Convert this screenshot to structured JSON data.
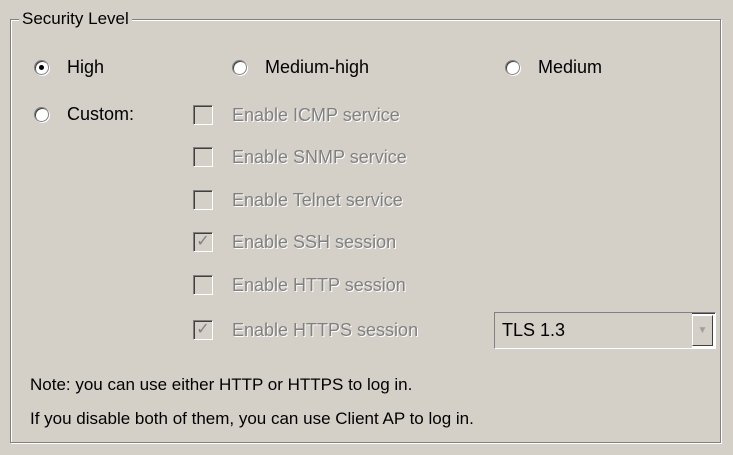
{
  "group": {
    "title": "Security Level"
  },
  "levels": {
    "high": "High",
    "medium_high": "Medium-high",
    "medium": "Medium",
    "custom": "Custom:",
    "selected": "high"
  },
  "services": [
    {
      "label": "Enable ICMP service",
      "checked": false,
      "enabled": false
    },
    {
      "label": "Enable SNMP service",
      "checked": false,
      "enabled": false
    },
    {
      "label": "Enable Telnet service",
      "checked": false,
      "enabled": false
    },
    {
      "label": "Enable SSH session",
      "checked": true,
      "enabled": false
    },
    {
      "label": "Enable HTTP session",
      "checked": false,
      "enabled": false
    },
    {
      "label": "Enable HTTPS session",
      "checked": true,
      "enabled": false
    }
  ],
  "tls": {
    "value": "TLS 1.3"
  },
  "note": {
    "line1": "Note: you can use either HTTP or HTTPS to log in.",
    "line2": " If you disable both of them, you can use Client AP to log in."
  },
  "colors": {
    "background": "#d4d0c8",
    "disabled_text": "#808080"
  }
}
